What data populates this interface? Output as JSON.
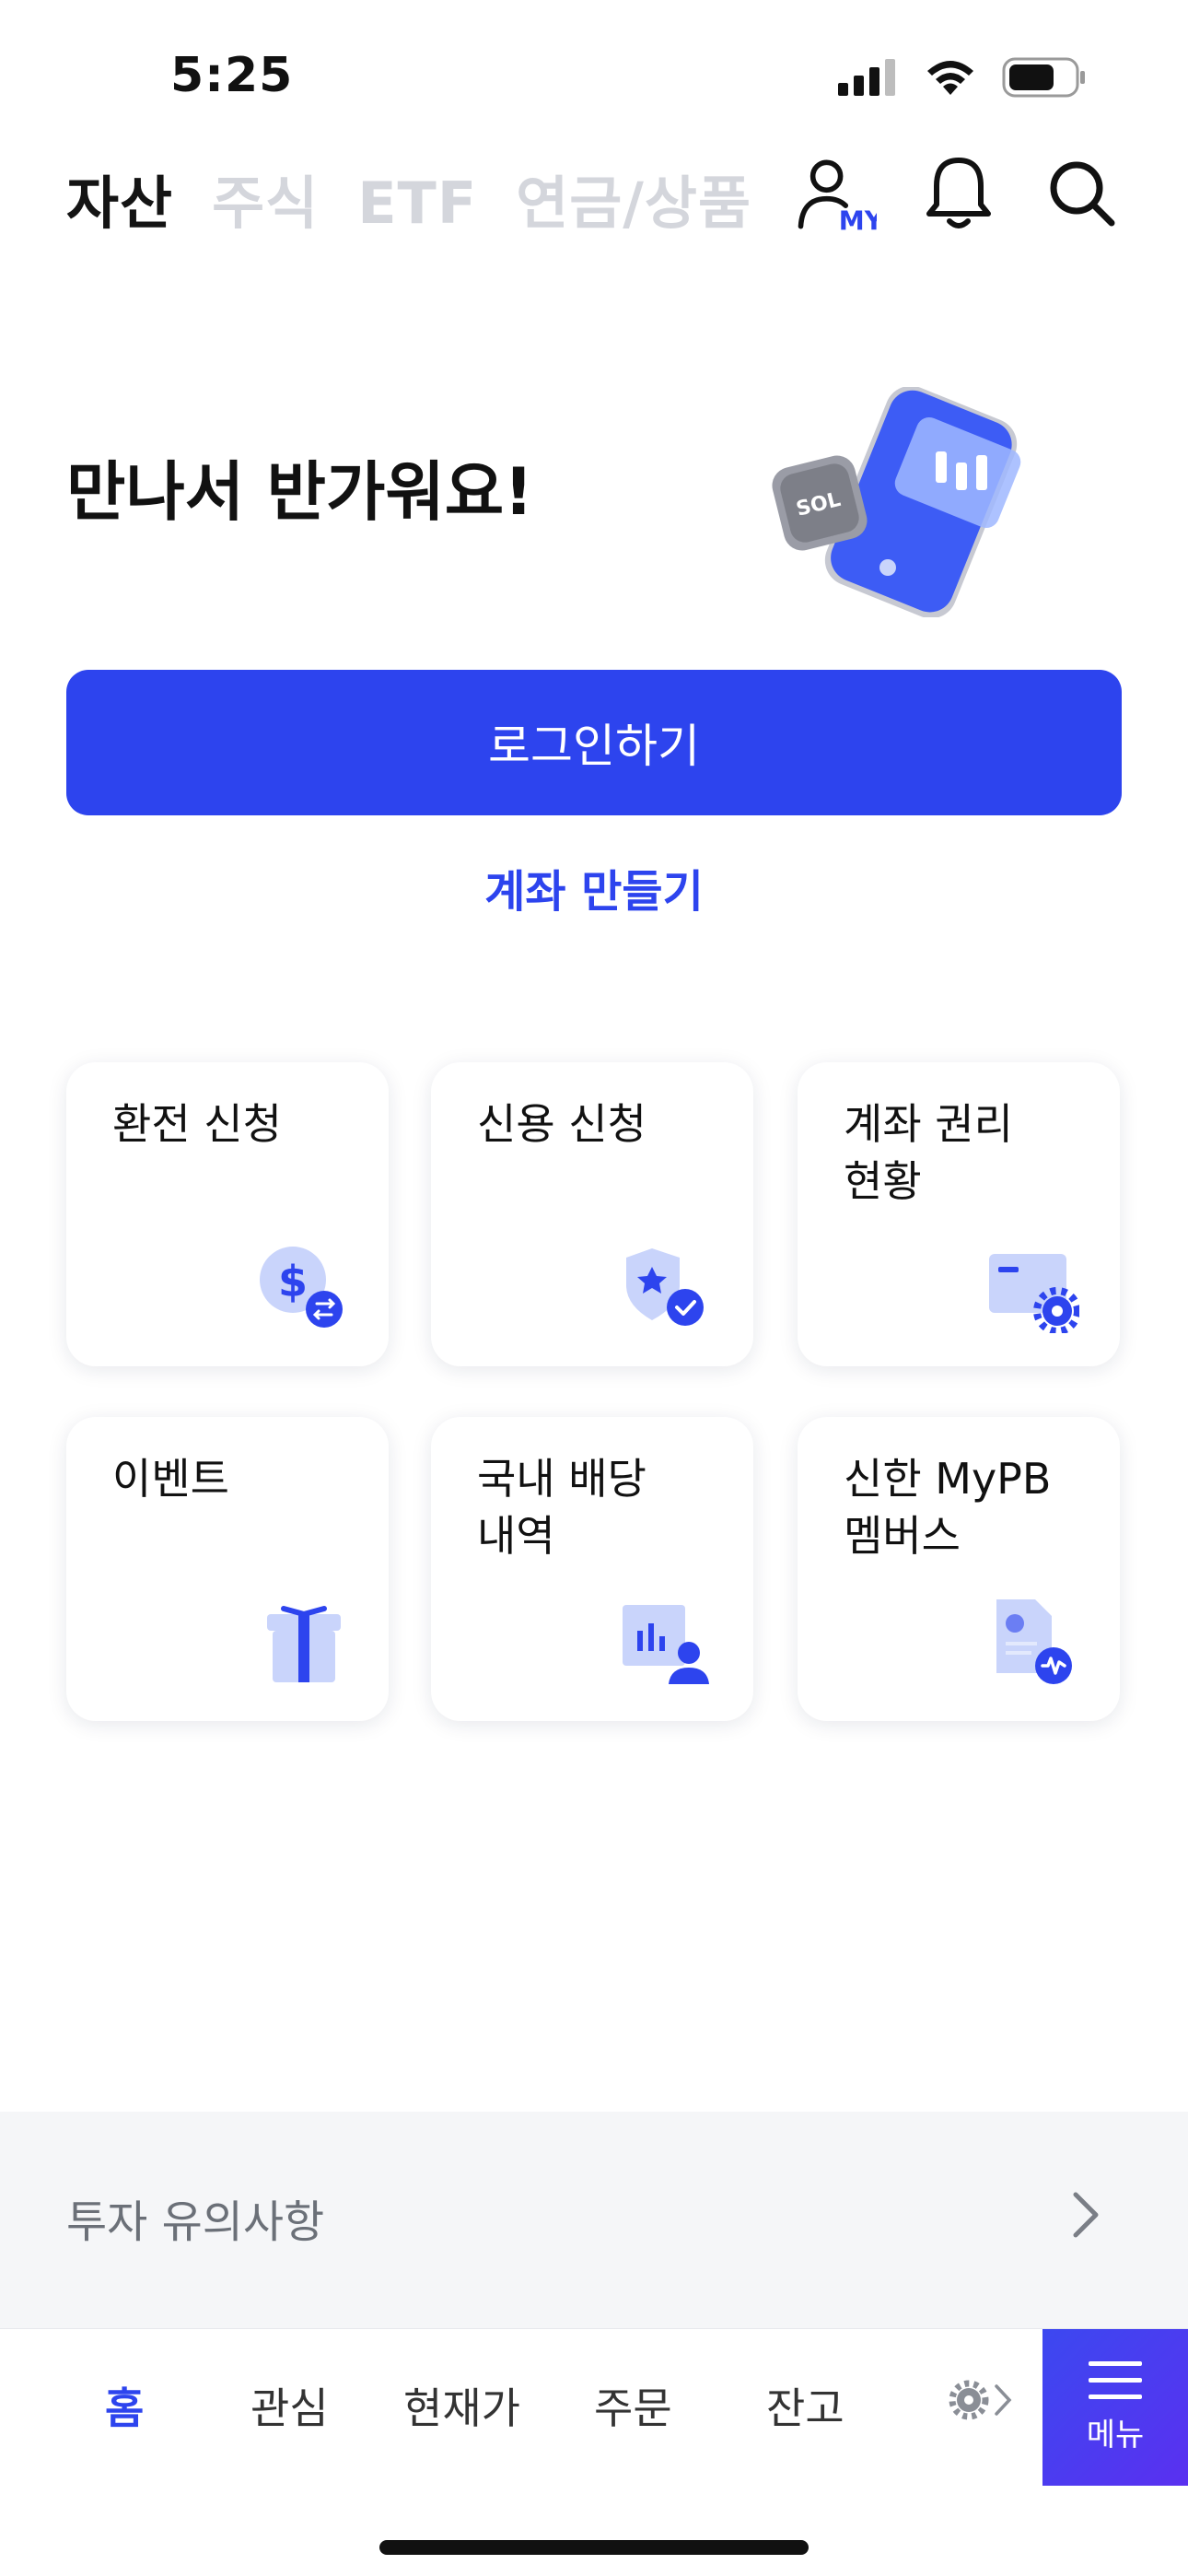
{
  "status": {
    "time": "5:25"
  },
  "top_nav": {
    "tabs": [
      {
        "label": "자산",
        "active": true
      },
      {
        "label": "주식",
        "active": false
      },
      {
        "label": "ETF",
        "active": false
      },
      {
        "label": "연금/상품",
        "active": false
      }
    ],
    "my_badge": "MY",
    "icons": [
      "my-profile-icon",
      "bell-icon",
      "search-icon"
    ]
  },
  "welcome": {
    "title": "만나서 반가워요!",
    "illustration_badge": "SOL"
  },
  "login_button": "로그인하기",
  "create_account": "계좌 만들기",
  "cards": [
    {
      "title": "환전 신청",
      "icon": "currency-exchange-icon"
    },
    {
      "title": "신용 신청",
      "icon": "credit-shield-icon"
    },
    {
      "title": "계좌 권리\n현황",
      "icon": "account-settings-icon"
    },
    {
      "title": "이벤트",
      "icon": "gift-icon"
    },
    {
      "title": "국내 배당\n내역",
      "icon": "dividend-chart-icon"
    },
    {
      "title": "신한 MyPB\n멤버스",
      "icon": "mypb-document-icon"
    }
  ],
  "notice": {
    "label": "투자 유의사항"
  },
  "bottom_nav": {
    "items": [
      {
        "label": "홈",
        "active": true
      },
      {
        "label": "관심",
        "active": false
      },
      {
        "label": "현재가",
        "active": false
      },
      {
        "label": "주문",
        "active": false
      },
      {
        "label": "잔고",
        "active": false
      }
    ],
    "menu_label": "메뉴"
  },
  "colors": {
    "accent": "#2d44ee",
    "inactive_tab": "#d4d6dc",
    "icon_light": "#c9d4fb"
  }
}
